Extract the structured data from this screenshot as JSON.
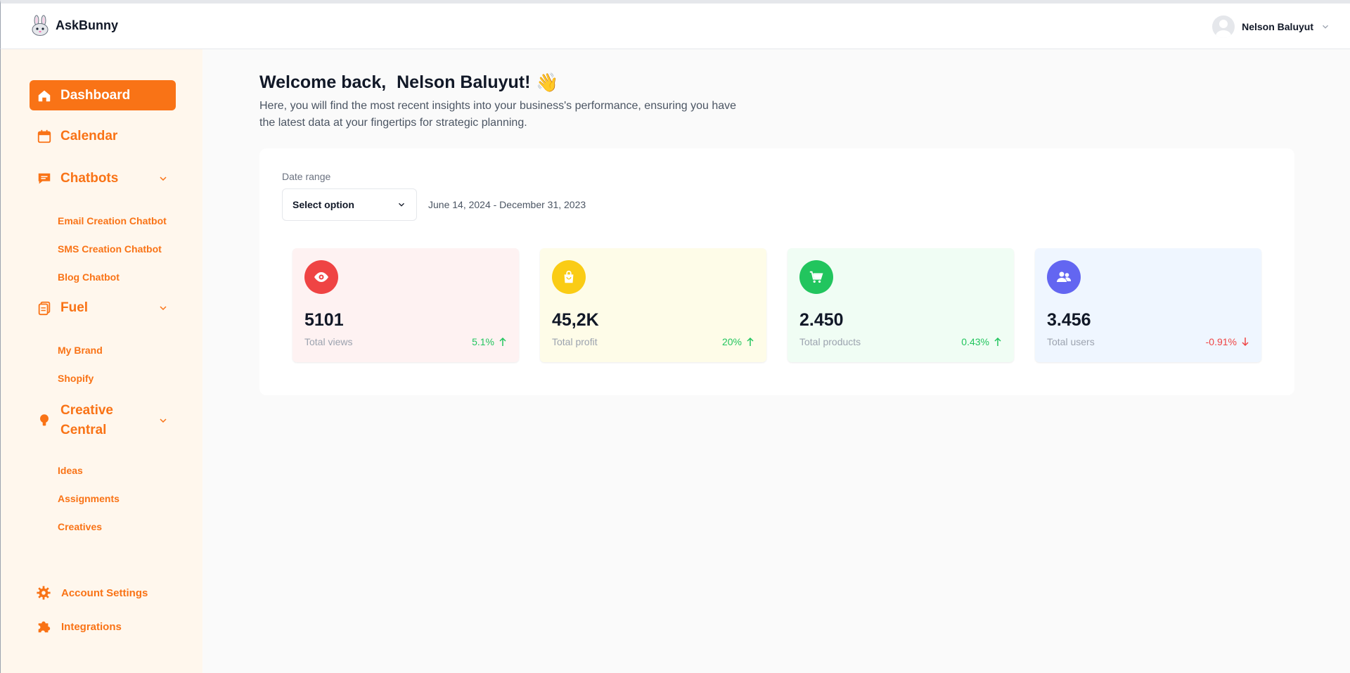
{
  "app": {
    "name": "AskBunny"
  },
  "user": {
    "name": "Nelson Baluyut"
  },
  "sidebar": {
    "items": [
      {
        "label": "Dashboard",
        "icon": "home-icon",
        "active": true
      },
      {
        "label": "Calendar",
        "icon": "calendar-icon"
      },
      {
        "label": "Chatbots",
        "icon": "chat-icon",
        "expanded": true,
        "children": [
          {
            "label": "Email Creation Chatbot"
          },
          {
            "label": "SMS Creation Chatbot"
          },
          {
            "label": "Blog Chatbot"
          }
        ]
      },
      {
        "label": "Fuel",
        "icon": "clipboard-icon",
        "expanded": true,
        "children": [
          {
            "label": "My Brand"
          },
          {
            "label": "Shopify"
          }
        ]
      },
      {
        "label": "Creative Central",
        "label_line1": "Creative",
        "label_line2": "Central",
        "icon": "lightbulb-icon",
        "expanded": true,
        "children": [
          {
            "label": "Ideas"
          },
          {
            "label": "Assignments"
          },
          {
            "label": "Creatives"
          }
        ]
      }
    ],
    "bottom": [
      {
        "label": "Account Settings",
        "icon": "gear-icon"
      },
      {
        "label": "Integrations",
        "icon": "puzzle-icon"
      }
    ]
  },
  "main": {
    "welcome_prefix": "Welcome back, ",
    "welcome_name": "Nelson Baluyut!",
    "wave": "👋",
    "subtitle": "Here, you will find the most recent insights into your business's performance, ensuring you have the latest data at your fingertips for strategic planning."
  },
  "filter": {
    "label": "Date range",
    "select_value": "Select option",
    "range_text": "June 14, 2024 - December 31, 2023"
  },
  "stats": [
    {
      "value": "5101",
      "caption": "Total views",
      "trend": "5.1%",
      "direction": "up",
      "icon": "eye-icon",
      "color": "#ef4444",
      "bg": "#fef2f2"
    },
    {
      "value": "45,2K",
      "caption": "Total profit",
      "trend": "20%",
      "direction": "up",
      "icon": "shopping-bag-icon",
      "color": "#facc15",
      "bg": "#fefce8"
    },
    {
      "value": "2.450",
      "caption": "Total products",
      "trend": "0.43%",
      "direction": "up",
      "icon": "cart-icon",
      "color": "#22c55e",
      "bg": "#f0fdf4"
    },
    {
      "value": "3.456",
      "caption": "Total users",
      "trend": "-0.91%",
      "direction": "down",
      "icon": "users-icon",
      "color": "#6366f1",
      "bg": "#eff6ff"
    }
  ],
  "colors": {
    "accent": "#f97316",
    "sidebar_bg": "#fff7ed",
    "up": "#22c55e",
    "down": "#ef4444"
  }
}
